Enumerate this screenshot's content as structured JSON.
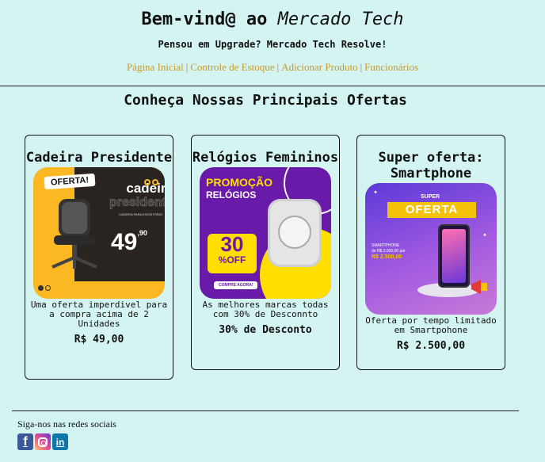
{
  "header": {
    "title_prefix": "Bem-vind@ ao ",
    "title_brand": "Mercado Tech",
    "tagline": "Pensou em Upgrade? Mercado Tech Resolve!"
  },
  "nav": {
    "items": [
      {
        "label": "Página Inicial"
      },
      {
        "label": "Controle de Estoque"
      },
      {
        "label": "Adicionar Produto"
      },
      {
        "label": "Funcionários"
      }
    ],
    "separator": "|"
  },
  "section": {
    "title": "Conheça Nossas Principais Ofertas"
  },
  "cards": [
    {
      "title": "Cadeira Presidente",
      "description": "Uma oferta imperdivel para a compra acima de 2 Unidades",
      "price": "R$ 49,00",
      "image": {
        "tag": "OFERTA!",
        "line1": "cadeira",
        "line2": "presidente",
        "sub": "CADEIRA PARA ESCRITÓRIO",
        "price_int": "49",
        "price_cents": ",90"
      }
    },
    {
      "title": "Relógios Femininos",
      "description": "As melhores marcas todas com 30% de Desconnto",
      "price": "30% de Desconto",
      "image": {
        "line1": "PROMOÇÃO",
        "line2": "RELÓGIOS",
        "pct": "30",
        "pct_label": "%OFF",
        "button": "COMPRE AGORA!"
      }
    },
    {
      "title": "Super oferta: Smartphone",
      "description": "Oferta por tempo limitado em Smartpohone",
      "price": "R$ 2.500,00",
      "image": {
        "super": "SUPER",
        "oferta": "OFERTA",
        "info1": "SMARTPHONE",
        "info2": "de R$ 3.000,00 por",
        "info3": "R$ 2.500,00"
      }
    }
  ],
  "footer": {
    "label": "Siga-nos nas redes sociais"
  },
  "social": [
    {
      "icon": "facebook-icon",
      "glyph": "f"
    },
    {
      "icon": "instagram-icon"
    },
    {
      "icon": "linkedin-icon",
      "glyph": "in"
    }
  ],
  "colors": {
    "background": "#d3f4f1",
    "nav_link": "#c89a2a"
  }
}
